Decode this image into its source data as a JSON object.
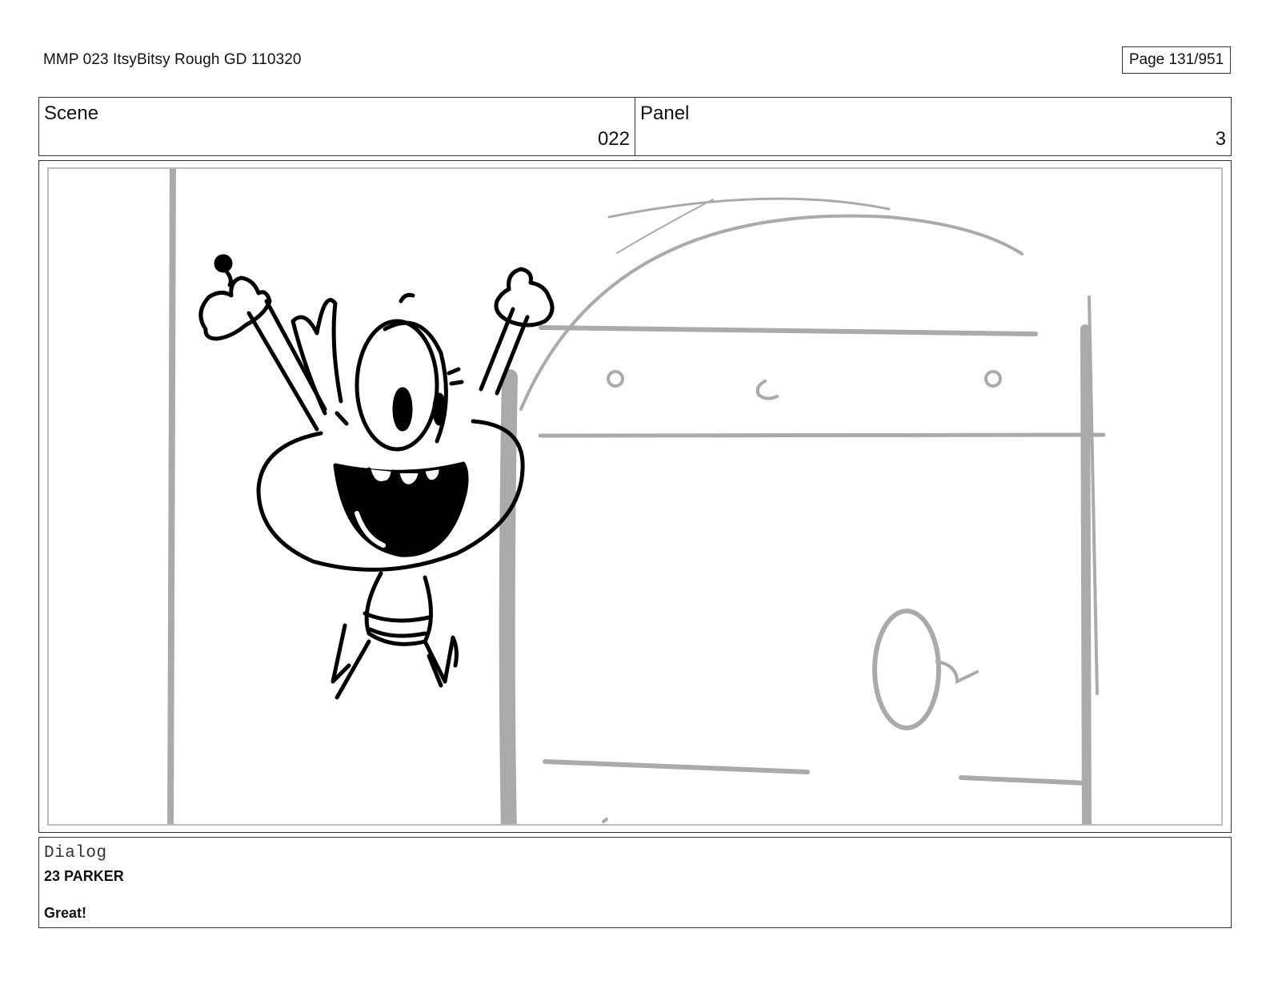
{
  "header": {
    "doc_title": "MMP 023 ItsyBitsy Rough GD 110320",
    "page_label": "Page 131/951"
  },
  "info": {
    "scene_label": "Scene",
    "scene_value": "022",
    "panel_label": "Panel",
    "panel_value": "3"
  },
  "sketch": {
    "description_icon": "storyboard-sketch-icon",
    "line_color": "#000000",
    "background_line_color": "#aaaaaa"
  },
  "dialog": {
    "heading": "Dialog",
    "speaker": "23 PARKER",
    "line": "Great!"
  }
}
